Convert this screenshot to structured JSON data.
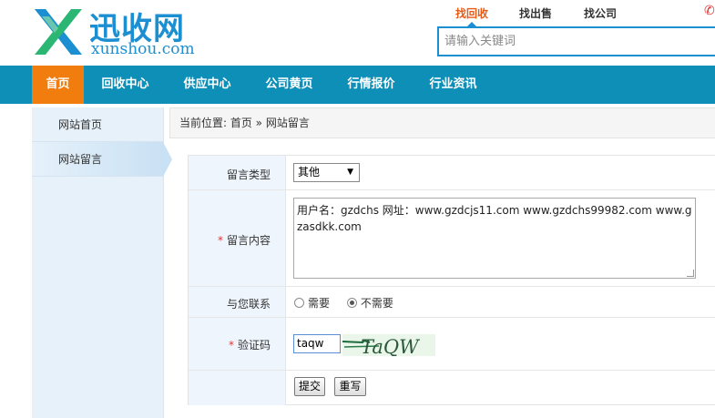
{
  "header": {
    "logo_cn": "迅收网",
    "logo_en": "xunshou.com",
    "search_tabs": [
      "找回收",
      "找出售",
      "找公司"
    ],
    "search_placeholder": "请输入关键词"
  },
  "nav": {
    "items": [
      "首页",
      "回收中心",
      "供应中心",
      "公司黄页",
      "行情报价",
      "行业资讯"
    ]
  },
  "sidebar": {
    "items": [
      "网站首页",
      "网站留言"
    ]
  },
  "breadcrumb": "当前位置: 首页 » 网站留言",
  "form": {
    "type_label": "留言类型",
    "type_value": "其他",
    "content_label": "留言内容",
    "content_value": "用户名：gzdchs    网址：www.gzdcjs11.com    www.gzdchs99982.com    www.gzasdkk.com",
    "contact_label": "与您联系",
    "contact_options": [
      "需要",
      "不需要"
    ],
    "contact_selected": "不需要",
    "captcha_label": "验证码",
    "captcha_value": "taqw",
    "captcha_image_text": "TaQW",
    "submit_label": "提交",
    "reset_label": "重写"
  },
  "colors": {
    "brand_blue": "#1b8fd1",
    "nav_bg": "#0e8fb8",
    "nav_active": "#f07d0e",
    "tab_active": "#e85b16",
    "required": "#ee3333"
  }
}
